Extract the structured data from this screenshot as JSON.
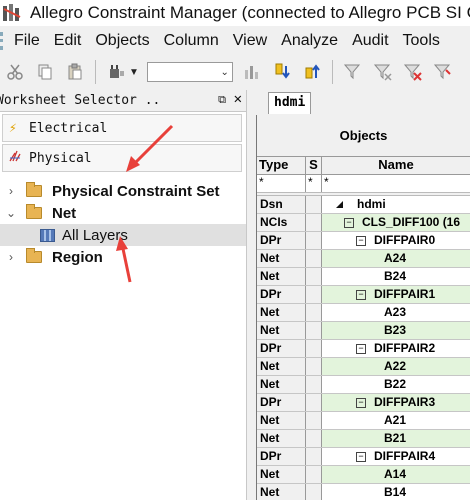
{
  "window": {
    "title": "Allegro Constraint Manager (connected to Allegro PCB SI GX"
  },
  "menu": [
    "File",
    "Edit",
    "Objects",
    "Column",
    "View",
    "Analyze",
    "Audit",
    "Tools"
  ],
  "toolbar": {
    "icons": [
      "cut-icon",
      "copy-icon",
      "paste-icon",
      "plug-icon",
      "chart-icon",
      "flag-down-icon",
      "flag-up-icon",
      "filter-icon",
      "filter-clear-icon",
      "filter-x-icon",
      "filter-flag-icon"
    ],
    "combo_value": ""
  },
  "worksheet": {
    "title": "Worksheet Selector ..",
    "tabs": [
      {
        "label": "Electrical",
        "icon": "lightning-icon"
      },
      {
        "label": "Physical",
        "icon": "physical-icon"
      }
    ],
    "tree": [
      {
        "label": "Physical Constraint Set",
        "expanded": false
      },
      {
        "label": "Net",
        "expanded": true
      },
      {
        "label": "All Layers",
        "selected": true
      },
      {
        "label": "Region",
        "expanded": false
      }
    ]
  },
  "document": {
    "tab": "hdmi",
    "group_header": "Objects",
    "columns": {
      "type": "Type",
      "s": "S",
      "name": "Name"
    },
    "filter": {
      "type": "*",
      "s": "*",
      "name": "*"
    },
    "rows": [
      {
        "type": "Dsn",
        "name": "hdmi",
        "level": 0,
        "marker": "tri",
        "bg": "white"
      },
      {
        "type": "NCIs",
        "name": "CLS_DIFF100 (16",
        "level": 1,
        "marker": "box",
        "bg": "green"
      },
      {
        "type": "DPr",
        "name": "DIFFPAIR0",
        "level": 2,
        "marker": "box",
        "bg": "white"
      },
      {
        "type": "Net",
        "name": "A24",
        "level": 3,
        "marker": "",
        "bg": "green"
      },
      {
        "type": "Net",
        "name": "B24",
        "level": 3,
        "marker": "",
        "bg": "white"
      },
      {
        "type": "DPr",
        "name": "DIFFPAIR1",
        "level": 2,
        "marker": "box",
        "bg": "green"
      },
      {
        "type": "Net",
        "name": "A23",
        "level": 3,
        "marker": "",
        "bg": "white"
      },
      {
        "type": "Net",
        "name": "B23",
        "level": 3,
        "marker": "",
        "bg": "green"
      },
      {
        "type": "DPr",
        "name": "DIFFPAIR2",
        "level": 2,
        "marker": "box",
        "bg": "white"
      },
      {
        "type": "Net",
        "name": "A22",
        "level": 3,
        "marker": "",
        "bg": "green"
      },
      {
        "type": "Net",
        "name": "B22",
        "level": 3,
        "marker": "",
        "bg": "white"
      },
      {
        "type": "DPr",
        "name": "DIFFPAIR3",
        "level": 2,
        "marker": "box",
        "bg": "green"
      },
      {
        "type": "Net",
        "name": "A21",
        "level": 3,
        "marker": "",
        "bg": "white"
      },
      {
        "type": "Net",
        "name": "B21",
        "level": 3,
        "marker": "",
        "bg": "green"
      },
      {
        "type": "DPr",
        "name": "DIFFPAIR4",
        "level": 2,
        "marker": "box",
        "bg": "white"
      },
      {
        "type": "Net",
        "name": "A14",
        "level": 3,
        "marker": "",
        "bg": "green"
      },
      {
        "type": "Net",
        "name": "B14",
        "level": 3,
        "marker": "",
        "bg": "white"
      }
    ]
  },
  "annotations": {
    "arrow_color": "#e8403a"
  }
}
